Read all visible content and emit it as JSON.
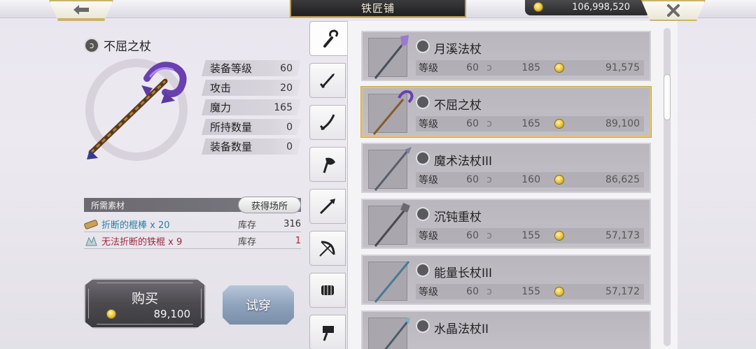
{
  "header": {
    "title": "铁匠铺",
    "gold": "106,998,520",
    "back_icon": "arrow-left-icon",
    "close_icon": "close-icon"
  },
  "item": {
    "name": "不屈之杖",
    "stats": [
      {
        "label": "装备等级",
        "value": "60"
      },
      {
        "label": "攻击",
        "value": "20"
      },
      {
        "label": "魔力",
        "value": "165"
      },
      {
        "label": "所持数量",
        "value": "0"
      },
      {
        "label": "装备数量",
        "value": "0"
      }
    ]
  },
  "materials": {
    "header": "所需素材",
    "acquire_label": "获得场所",
    "stock_label": "库存",
    "rows": [
      {
        "name": "折断的棍棒 x 20",
        "stock": "316",
        "name_color": "#2e7ea0",
        "stock_color": "#333333"
      },
      {
        "name": "无法折断的铁棍 x 9",
        "stock": "1",
        "name_color": "#9a2a3a",
        "stock_color": "#b02030"
      }
    ]
  },
  "actions": {
    "buy_label": "购买",
    "buy_price": "89,100",
    "try_label": "试穿"
  },
  "tabs": [
    {
      "icon": "staff-icon",
      "active": true
    },
    {
      "icon": "sword-icon",
      "active": false
    },
    {
      "icon": "katana-icon",
      "active": false
    },
    {
      "icon": "axe-icon",
      "active": false
    },
    {
      "icon": "spear-icon",
      "active": false
    },
    {
      "icon": "bow-icon",
      "active": false
    },
    {
      "icon": "fist-icon",
      "active": false
    },
    {
      "icon": "hammer-icon",
      "active": false
    }
  ],
  "list": {
    "level_label": "等级",
    "items": [
      {
        "name": "月溪法杖",
        "level": "60",
        "magic": "185",
        "price": "91,575",
        "selected": false
      },
      {
        "name": "不屈之杖",
        "level": "60",
        "magic": "165",
        "price": "89,100",
        "selected": true
      },
      {
        "name": "魔术法杖III",
        "level": "60",
        "magic": "160",
        "price": "86,625",
        "selected": false
      },
      {
        "name": "沉钝重杖",
        "level": "60",
        "magic": "155",
        "price": "57,173",
        "selected": false
      },
      {
        "name": "能量长杖III",
        "level": "60",
        "magic": "155",
        "price": "57,172",
        "selected": false
      },
      {
        "name": "水晶法杖II",
        "level": "",
        "magic": "",
        "price": "",
        "selected": false
      }
    ]
  },
  "colors": {
    "accent_gold": "#cbb36a",
    "title_bg": "#2a2a2c",
    "selected_border": "#e2c374"
  }
}
